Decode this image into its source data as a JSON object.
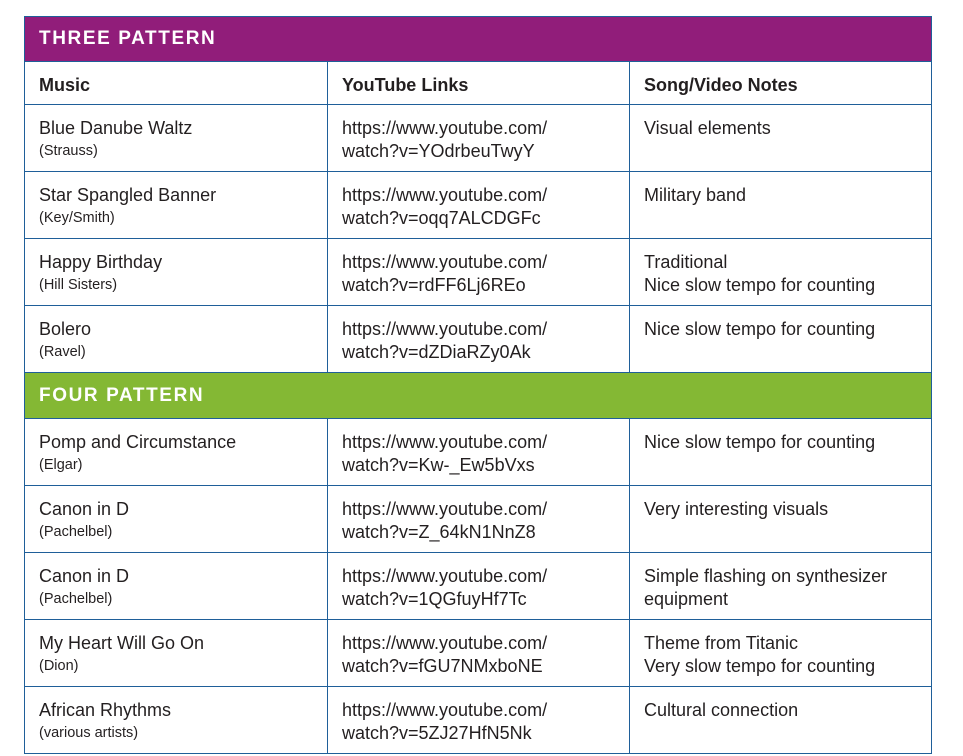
{
  "colors": {
    "three_pattern": "#911d7a",
    "four_pattern": "#84b834",
    "border": "#1f5f99"
  },
  "columns": [
    "Music",
    "YouTube Links",
    "Song/Video Notes"
  ],
  "sections": [
    {
      "title": "THREE PATTERN",
      "show_header": true,
      "rows": [
        {
          "title": "Blue Danube Waltz",
          "composer": "(Strauss)",
          "link1": "https://www.youtube.com/",
          "link2": "watch?v=YOdrbeuTwyY",
          "notes": [
            "Visual elements"
          ]
        },
        {
          "title": "Star Spangled Banner",
          "composer": "(Key/Smith)",
          "link1": "https://www.youtube.com/",
          "link2": "watch?v=oqq7ALCDGFc",
          "notes": [
            "Military band"
          ]
        },
        {
          "title": "Happy Birthday",
          "composer": "(Hill Sisters)",
          "link1": "https://www.youtube.com/",
          "link2": "watch?v=rdFF6Lj6REo",
          "notes": [
            "Traditional",
            "Nice slow tempo for counting"
          ]
        },
        {
          "title": "Bolero",
          "composer": "(Ravel)",
          "link1": "https://www.youtube.com/",
          "link2": "watch?v=dZDiaRZy0Ak",
          "notes": [
            "Nice slow tempo for counting"
          ]
        }
      ]
    },
    {
      "title": "FOUR PATTERN",
      "show_header": false,
      "rows": [
        {
          "title": "Pomp and Circumstance",
          "composer": "(Elgar)",
          "link1": "https://www.youtube.com/",
          "link2": "watch?v=Kw-_Ew5bVxs",
          "notes": [
            "Nice slow tempo for counting"
          ]
        },
        {
          "title": "Canon in D",
          "composer": "(Pachelbel)",
          "link1": "https://www.youtube.com/",
          "link2": "watch?v=Z_64kN1NnZ8",
          "notes": [
            "Very interesting visuals"
          ]
        },
        {
          "title": "Canon in D",
          "composer": "(Pachelbel)",
          "link1": "https://www.youtube.com/",
          "link2": "watch?v=1QGfuyHf7Tc",
          "notes": [
            "Simple flashing on synthesizer",
            "equipment"
          ]
        },
        {
          "title": "My Heart Will Go On",
          "composer": "(Dion)",
          "link1": "https://www.youtube.com/",
          "link2": "watch?v=fGU7NMxboNE",
          "notes": [
            "Theme from Titanic",
            "Very slow tempo for counting"
          ]
        },
        {
          "title": "African Rhythms",
          "composer": "(various artists)",
          "link1": "https://www.youtube.com/",
          "link2": "watch?v=5ZJ27HfN5Nk",
          "notes": [
            "Cultural connection"
          ]
        }
      ]
    }
  ]
}
